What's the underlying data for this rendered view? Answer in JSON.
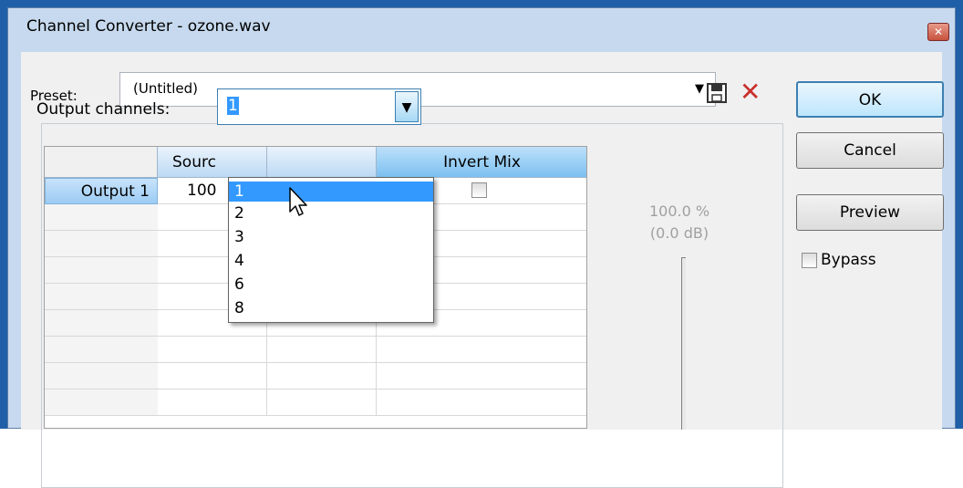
{
  "window": {
    "title": "Channel Converter - ozone.wav",
    "close_icon": "close-icon"
  },
  "preset": {
    "label": "Preset:",
    "value": "(Untitled)"
  },
  "buttons": {
    "ok": "OK",
    "cancel": "Cancel",
    "preview": "Preview"
  },
  "bypass": {
    "label": "Bypass",
    "checked": false
  },
  "output_channels": {
    "label": "Output channels:",
    "selected": "1",
    "options": [
      "1",
      "2",
      "3",
      "4",
      "6",
      "8"
    ],
    "highlighted": "1"
  },
  "grid": {
    "headers": {
      "source": "Sourc",
      "invert_mix": "Invert Mix"
    },
    "rows": [
      {
        "label": "Output 1",
        "source": "100",
        "invert": false
      }
    ]
  },
  "meter": {
    "percent": "100.0 %",
    "db": "(0.0 dB)"
  }
}
